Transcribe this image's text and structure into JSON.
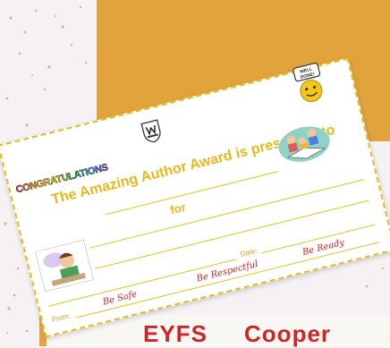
{
  "certificate": {
    "congrats_label": "CONGRATULATIONS",
    "title": "The Amazing Author Award is presented to",
    "for_label": "for",
    "date_label": "Date:",
    "from_label": "From:",
    "values": [
      "Be Safe",
      "Be Respectful",
      "Be Ready"
    ],
    "medal_text": "WELL DONE!"
  },
  "footer": {
    "text": "EYFS     Cooper"
  },
  "colors": {
    "panel": "#e3a33c",
    "certificate_border": "#e3bd1f",
    "title_text": "#e9b718",
    "values_text": "#cc2222",
    "footer_text": "#cc2626"
  }
}
